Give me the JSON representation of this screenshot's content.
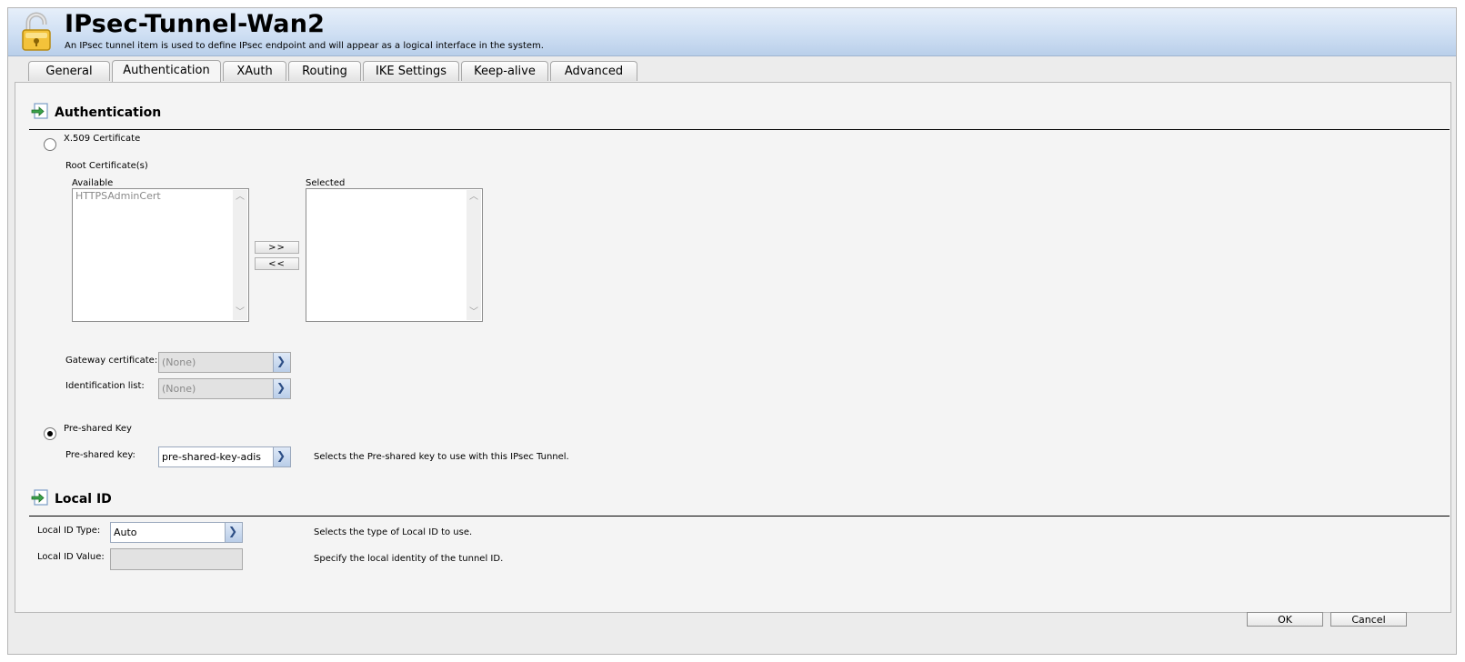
{
  "header": {
    "title": "IPsec-Tunnel-Wan2",
    "subtitle": "An IPsec tunnel item is used to define IPsec endpoint and will appear as a logical interface in the system."
  },
  "tabs": [
    {
      "label": "General",
      "active": false
    },
    {
      "label": "Authentication",
      "active": true
    },
    {
      "label": "XAuth",
      "active": false
    },
    {
      "label": "Routing",
      "active": false
    },
    {
      "label": "IKE Settings",
      "active": false
    },
    {
      "label": "Keep-alive",
      "active": false
    },
    {
      "label": "Advanced",
      "active": false
    }
  ],
  "authentication": {
    "heading": "Authentication",
    "x509_label": "X.509 Certificate",
    "x509_selected": false,
    "root_cert_label": "Root Certificate(s)",
    "available_label": "Available",
    "available_items": [
      "HTTPSAdminCert"
    ],
    "selected_label": "Selected",
    "selected_items": [],
    "add_button": ">>",
    "remove_button": "<<",
    "gateway_cert_label": "Gateway certificate:",
    "gateway_cert_value": "(None)",
    "identification_list_label": "Identification list:",
    "identification_list_value": "(None)",
    "psk_label": "Pre-shared Key",
    "psk_selected": true,
    "psk_field_label": "Pre-shared key:",
    "psk_value": "pre-shared-key-adis",
    "psk_hint": "Selects the Pre-shared key to use with this IPsec Tunnel."
  },
  "local_id": {
    "heading": "Local ID",
    "type_label": "Local ID Type:",
    "type_value": "Auto",
    "type_hint": "Selects the type of Local ID to use.",
    "value_label": "Local ID Value:",
    "value_value": "",
    "value_hint": "Specify the local identity of the tunnel ID."
  },
  "footer": {
    "ok_label": "OK",
    "cancel_label": "Cancel"
  }
}
